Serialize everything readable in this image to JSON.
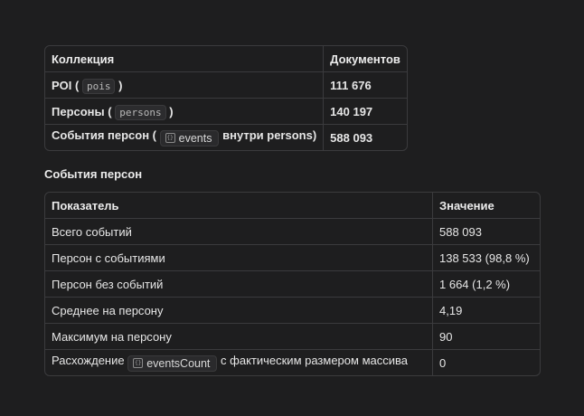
{
  "collections_table": {
    "headers": [
      "Коллекция",
      "Документов"
    ],
    "rows": [
      {
        "name": "POI",
        "code": "pois",
        "open": " (",
        "close": ")",
        "count": "111 676"
      },
      {
        "name": "Персоны",
        "code": "persons",
        "open": " (",
        "close": ")",
        "count": "140 197"
      },
      {
        "name": "События персон",
        "open": " (",
        "chip_icon": "field-icon",
        "chip": "events",
        "rest": "внутри persons)",
        "count": "588 093"
      }
    ]
  },
  "section_title": "События персон",
  "events_table": {
    "headers": [
      "Показатель",
      "Значение"
    ],
    "rows": [
      {
        "label": "Всего событий",
        "value": "588 093"
      },
      {
        "label": "Персон с событиями",
        "value": "138 533 (98,8 %)"
      },
      {
        "label": "Персон без событий",
        "value": "1 664 (1,2 %)"
      },
      {
        "label": "Среднее на персону",
        "value": "4,19"
      },
      {
        "label": "Максимум на персону",
        "value": "90"
      },
      {
        "label_before": "Расхождение",
        "chip_icon": "field-icon",
        "chip": "eventsCount",
        "label_after": "с фактическим размером массива",
        "value": "0"
      }
    ]
  }
}
